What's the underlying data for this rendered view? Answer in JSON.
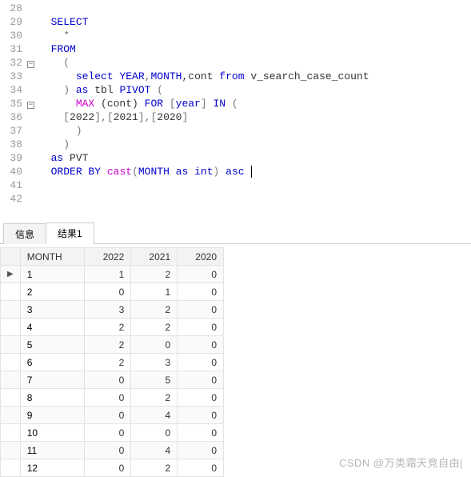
{
  "editor": {
    "lines": [
      {
        "n": 28,
        "fold": "",
        "tokens": []
      },
      {
        "n": 29,
        "fold": "",
        "tokens": [
          {
            "t": "  ",
            "c": ""
          },
          {
            "t": "SELECT",
            "c": "kw"
          }
        ]
      },
      {
        "n": 30,
        "fold": "",
        "tokens": [
          {
            "t": "    *",
            "c": "op"
          }
        ]
      },
      {
        "n": 31,
        "fold": "",
        "tokens": [
          {
            "t": "  ",
            "c": ""
          },
          {
            "t": "FROM",
            "c": "kw"
          }
        ]
      },
      {
        "n": 32,
        "fold": "box",
        "tokens": [
          {
            "t": "    (",
            "c": "op"
          }
        ]
      },
      {
        "n": 33,
        "fold": "",
        "tokens": [
          {
            "t": "      ",
            "c": ""
          },
          {
            "t": "select",
            "c": "kw"
          },
          {
            "t": " ",
            "c": ""
          },
          {
            "t": "YEAR",
            "c": "kw"
          },
          {
            "t": ",",
            "c": "op"
          },
          {
            "t": "MONTH",
            "c": "kw"
          },
          {
            "t": ",cont ",
            "c": "id"
          },
          {
            "t": "from",
            "c": "kw"
          },
          {
            "t": " v_search_case_count",
            "c": "id"
          }
        ]
      },
      {
        "n": 34,
        "fold": "",
        "tokens": [
          {
            "t": "    ) ",
            "c": "op"
          },
          {
            "t": "as",
            "c": "kw"
          },
          {
            "t": " tbl ",
            "c": "id"
          },
          {
            "t": "PIVOT",
            "c": "kw"
          },
          {
            "t": " (",
            "c": "op"
          }
        ]
      },
      {
        "n": 35,
        "fold": "box",
        "tokens": [
          {
            "t": "      ",
            "c": ""
          },
          {
            "t": "MAX",
            "c": "fn"
          },
          {
            "t": " (cont) ",
            "c": "id"
          },
          {
            "t": "FOR",
            "c": "kw"
          },
          {
            "t": " [",
            "c": "op"
          },
          {
            "t": "year",
            "c": "kw"
          },
          {
            "t": "] ",
            "c": "op"
          },
          {
            "t": "IN",
            "c": "kw"
          },
          {
            "t": " (",
            "c": "op"
          }
        ]
      },
      {
        "n": 36,
        "fold": "",
        "tokens": [
          {
            "t": "    [",
            "c": "op"
          },
          {
            "t": "2022",
            "c": "num"
          },
          {
            "t": "],[",
            "c": "op"
          },
          {
            "t": "2021",
            "c": "num"
          },
          {
            "t": "],[",
            "c": "op"
          },
          {
            "t": "2020",
            "c": "num"
          },
          {
            "t": "]",
            "c": "op"
          }
        ]
      },
      {
        "n": 37,
        "fold": "",
        "tokens": [
          {
            "t": "      )",
            "c": "op"
          }
        ]
      },
      {
        "n": 38,
        "fold": "",
        "tokens": [
          {
            "t": "    )",
            "c": "op"
          }
        ]
      },
      {
        "n": 39,
        "fold": "",
        "tokens": [
          {
            "t": "  ",
            "c": ""
          },
          {
            "t": "as",
            "c": "kw"
          },
          {
            "t": " PVT",
            "c": "id"
          }
        ]
      },
      {
        "n": 40,
        "fold": "",
        "tokens": [
          {
            "t": "  ",
            "c": ""
          },
          {
            "t": "ORDER BY",
            "c": "kw"
          },
          {
            "t": " ",
            "c": ""
          },
          {
            "t": "cast",
            "c": "fn"
          },
          {
            "t": "(",
            "c": "op"
          },
          {
            "t": "MONTH",
            "c": "kw"
          },
          {
            "t": " ",
            "c": ""
          },
          {
            "t": "as",
            "c": "kw"
          },
          {
            "t": " ",
            "c": ""
          },
          {
            "t": "int",
            "c": "kw"
          },
          {
            "t": ") ",
            "c": "op"
          },
          {
            "t": "asc",
            "c": "kw"
          },
          {
            "t": " ",
            "c": ""
          }
        ],
        "cursor": true
      },
      {
        "n": 41,
        "fold": "",
        "tokens": []
      },
      {
        "n": 42,
        "fold": "",
        "tokens": []
      }
    ]
  },
  "tabs": {
    "items": [
      {
        "label": "信息"
      },
      {
        "label": "结果1"
      }
    ],
    "active": 1
  },
  "results": {
    "columns": [
      "MONTH",
      "2022",
      "2021",
      "2020"
    ],
    "rows": [
      [
        "1",
        1,
        2,
        0
      ],
      [
        "2",
        0,
        1,
        0
      ],
      [
        "3",
        3,
        2,
        0
      ],
      [
        "4",
        2,
        2,
        0
      ],
      [
        "5",
        2,
        0,
        0
      ],
      [
        "6",
        2,
        3,
        0
      ],
      [
        "7",
        0,
        5,
        0
      ],
      [
        "8",
        0,
        2,
        0
      ],
      [
        "9",
        0,
        4,
        0
      ],
      [
        "10",
        0,
        0,
        0
      ],
      [
        "11",
        0,
        4,
        0
      ],
      [
        "12",
        0,
        2,
        0
      ]
    ],
    "row_indicator": "▶"
  },
  "watermark": "CSDN @万类霜天竞自由|"
}
